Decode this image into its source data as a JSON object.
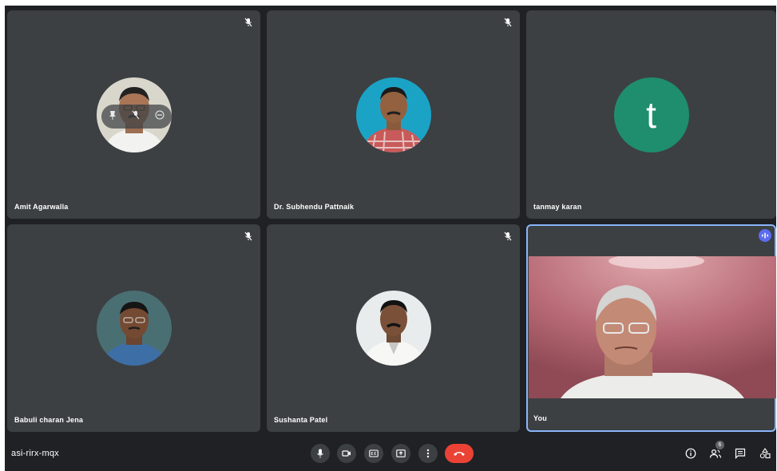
{
  "meeting": {
    "code": "asi-rirx-mqx"
  },
  "participants": [
    {
      "name": "Amit Agarwalla",
      "muted": true
    },
    {
      "name": "Dr. Subhendu Pattnaik",
      "muted": true
    },
    {
      "name": "tanmay karan",
      "muted": false,
      "initial": "t",
      "avatar_color": "#1e8e6e"
    },
    {
      "name": "Babuli charan Jena",
      "muted": true
    },
    {
      "name": "Sushanta Patel",
      "muted": true
    },
    {
      "name": "You",
      "muted": false,
      "speaking": true
    }
  ],
  "controls": {
    "participant_count": "6",
    "hangup_color": "#ea4335",
    "accent_color": "#8ab4f8"
  }
}
